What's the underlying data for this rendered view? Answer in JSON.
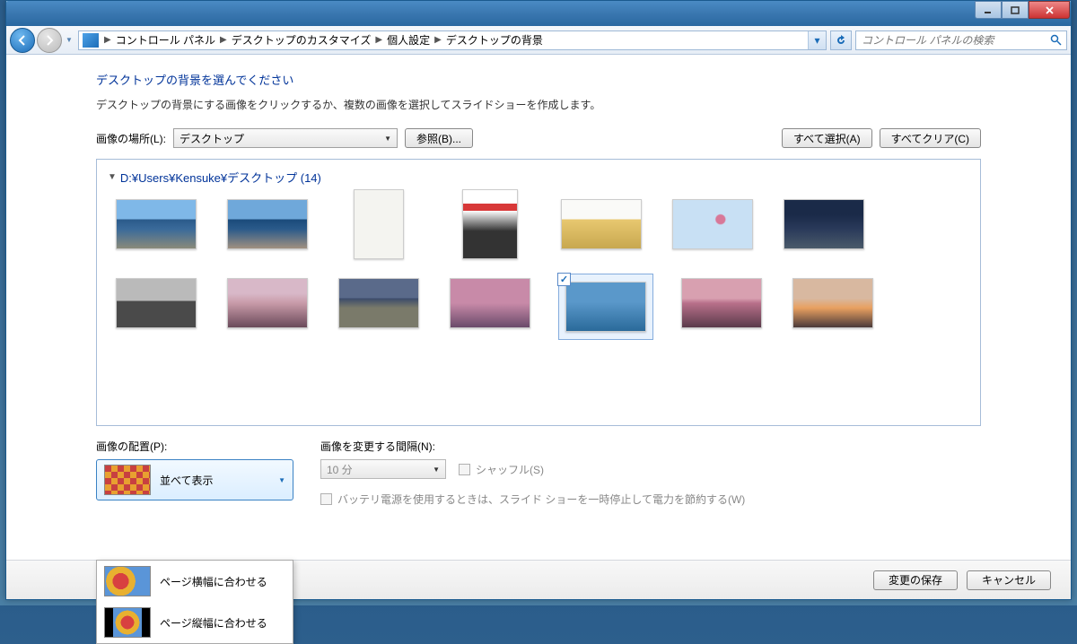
{
  "breadcrumb": {
    "items": [
      "コントロール パネル",
      "デスクトップのカスタマイズ",
      "個人設定",
      "デスクトップの背景"
    ]
  },
  "search": {
    "placeholder": "コントロール パネルの検索"
  },
  "page": {
    "heading": "デスクトップの背景を選んでください",
    "desc": "デスクトップの背景にする画像をクリックするか、複数の画像を選択してスライドショーを作成します。"
  },
  "location": {
    "label": "画像の場所(L):",
    "value": "デスクトップ",
    "browse": "参照(B)..."
  },
  "buttons": {
    "select_all": "すべて選択(A)",
    "clear_all": "すべてクリア(C)",
    "save": "変更の保存",
    "cancel": "キャンセル"
  },
  "gallery": {
    "folder_label": "D:¥Users¥Kensuke¥デスクトップ (14)",
    "selected_index": 11
  },
  "position": {
    "label": "画像の配置(P):",
    "selected": "並べて表示",
    "options": [
      "ページ横幅に合わせる",
      "ページ縦幅に合わせる"
    ]
  },
  "interval": {
    "label": "画像を変更する間隔(N):",
    "value": "10 分",
    "shuffle": "シャッフル(S)",
    "battery": "バッテリ電源を使用するときは、スライド ショーを一時停止して電力を節約する(W)"
  }
}
